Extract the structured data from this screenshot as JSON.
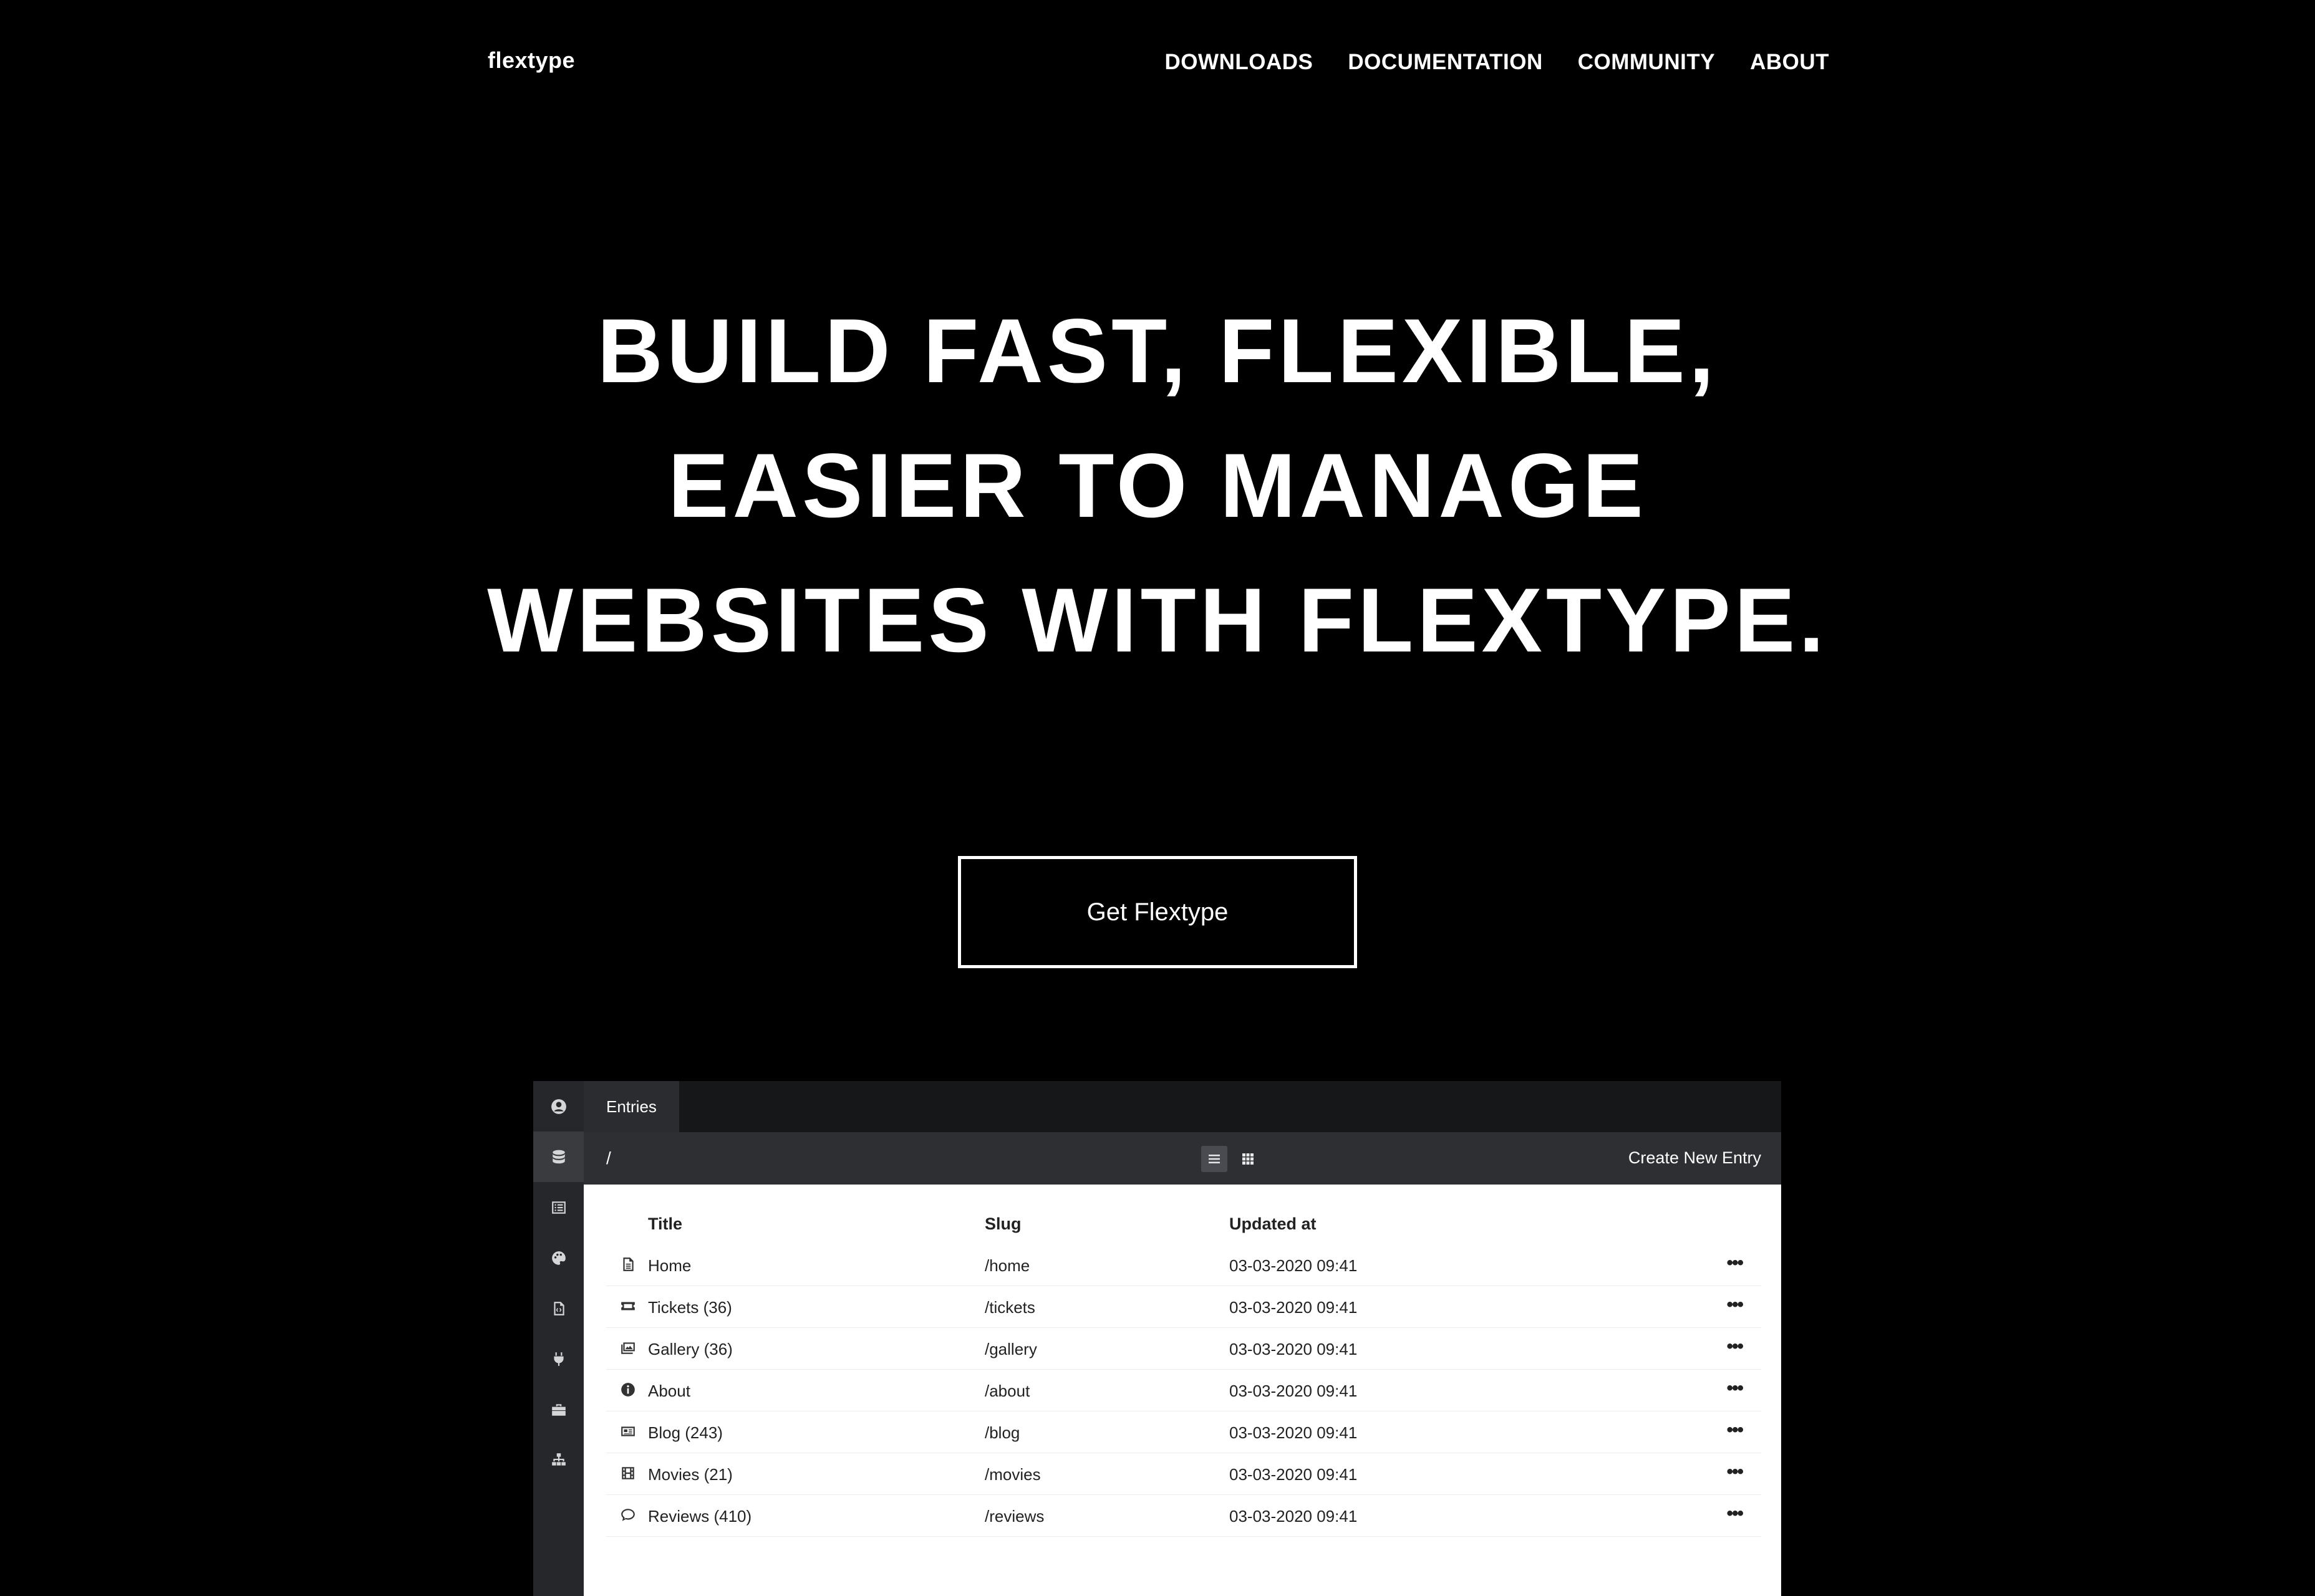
{
  "header": {
    "brand": "flextype",
    "nav": [
      "DOWNLOADS",
      "DOCUMENTATION",
      "COMMUNITY",
      "ABOUT"
    ]
  },
  "hero": {
    "lines": [
      "BUILD FAST, FLEXIBLE,",
      "EASIER TO MANAGE",
      "WEBSITES WITH FLEXTYPE."
    ],
    "cta": "Get Flextype"
  },
  "app": {
    "rail_icons": [
      "user-circle-icon",
      "database-icon",
      "list-icon",
      "palette-icon",
      "file-code-icon",
      "plug-icon",
      "toolbox-icon",
      "sitemap-icon"
    ],
    "tab": "Entries",
    "path": "/",
    "create": "Create New Entry",
    "columns": [
      "Title",
      "Slug",
      "Updated at"
    ],
    "rows": [
      {
        "icon": "file-icon",
        "title": "Home",
        "slug": "/home",
        "updated": "03-03-2020 09:41"
      },
      {
        "icon": "ticket-icon",
        "title": "Tickets (36)",
        "slug": "/tickets",
        "updated": "03-03-2020 09:41"
      },
      {
        "icon": "images-icon",
        "title": "Gallery (36)",
        "slug": "/gallery",
        "updated": "03-03-2020 09:41"
      },
      {
        "icon": "info-icon",
        "title": "About",
        "slug": "/about",
        "updated": "03-03-2020 09:41"
      },
      {
        "icon": "newspaper-icon",
        "title": "Blog (243)",
        "slug": "/blog",
        "updated": "03-03-2020 09:41"
      },
      {
        "icon": "film-icon",
        "title": "Movies (21)",
        "slug": "/movies",
        "updated": "03-03-2020 09:41"
      },
      {
        "icon": "comment-icon",
        "title": "Reviews (410)",
        "slug": "/reviews",
        "updated": "03-03-2020 09:41"
      }
    ],
    "row_menu": "•••"
  }
}
